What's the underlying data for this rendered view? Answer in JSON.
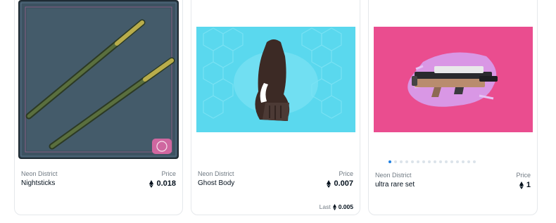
{
  "cards": [
    {
      "collection": "Neon District",
      "name": "Nightsticks",
      "price_label": "Price",
      "price": "0.018",
      "image": "nightsticks-artwork",
      "colors": {
        "frame": "#1e2a33",
        "bg": "#3b4f5c",
        "accent": "#e86aa9"
      }
    },
    {
      "collection": "Neon District",
      "name": "Ghost Body",
      "price_label": "Price",
      "price": "0.007",
      "last_label": "Last",
      "last_price": "0.005",
      "image": "ghost-body-artwork",
      "colors": {
        "bg": "#5ad8ee",
        "accent": "#3c2a25"
      }
    },
    {
      "collection": "Neon District",
      "name": "ultra rare set",
      "price_label": "Price",
      "price": "1",
      "image": "weapon-artwork",
      "colors": {
        "bg": "#ea4d8f",
        "accent": "#d7a0ee"
      },
      "carousel_total": 16,
      "carousel_active": 0
    }
  ],
  "icons": {
    "currency": "ethereum-icon"
  }
}
